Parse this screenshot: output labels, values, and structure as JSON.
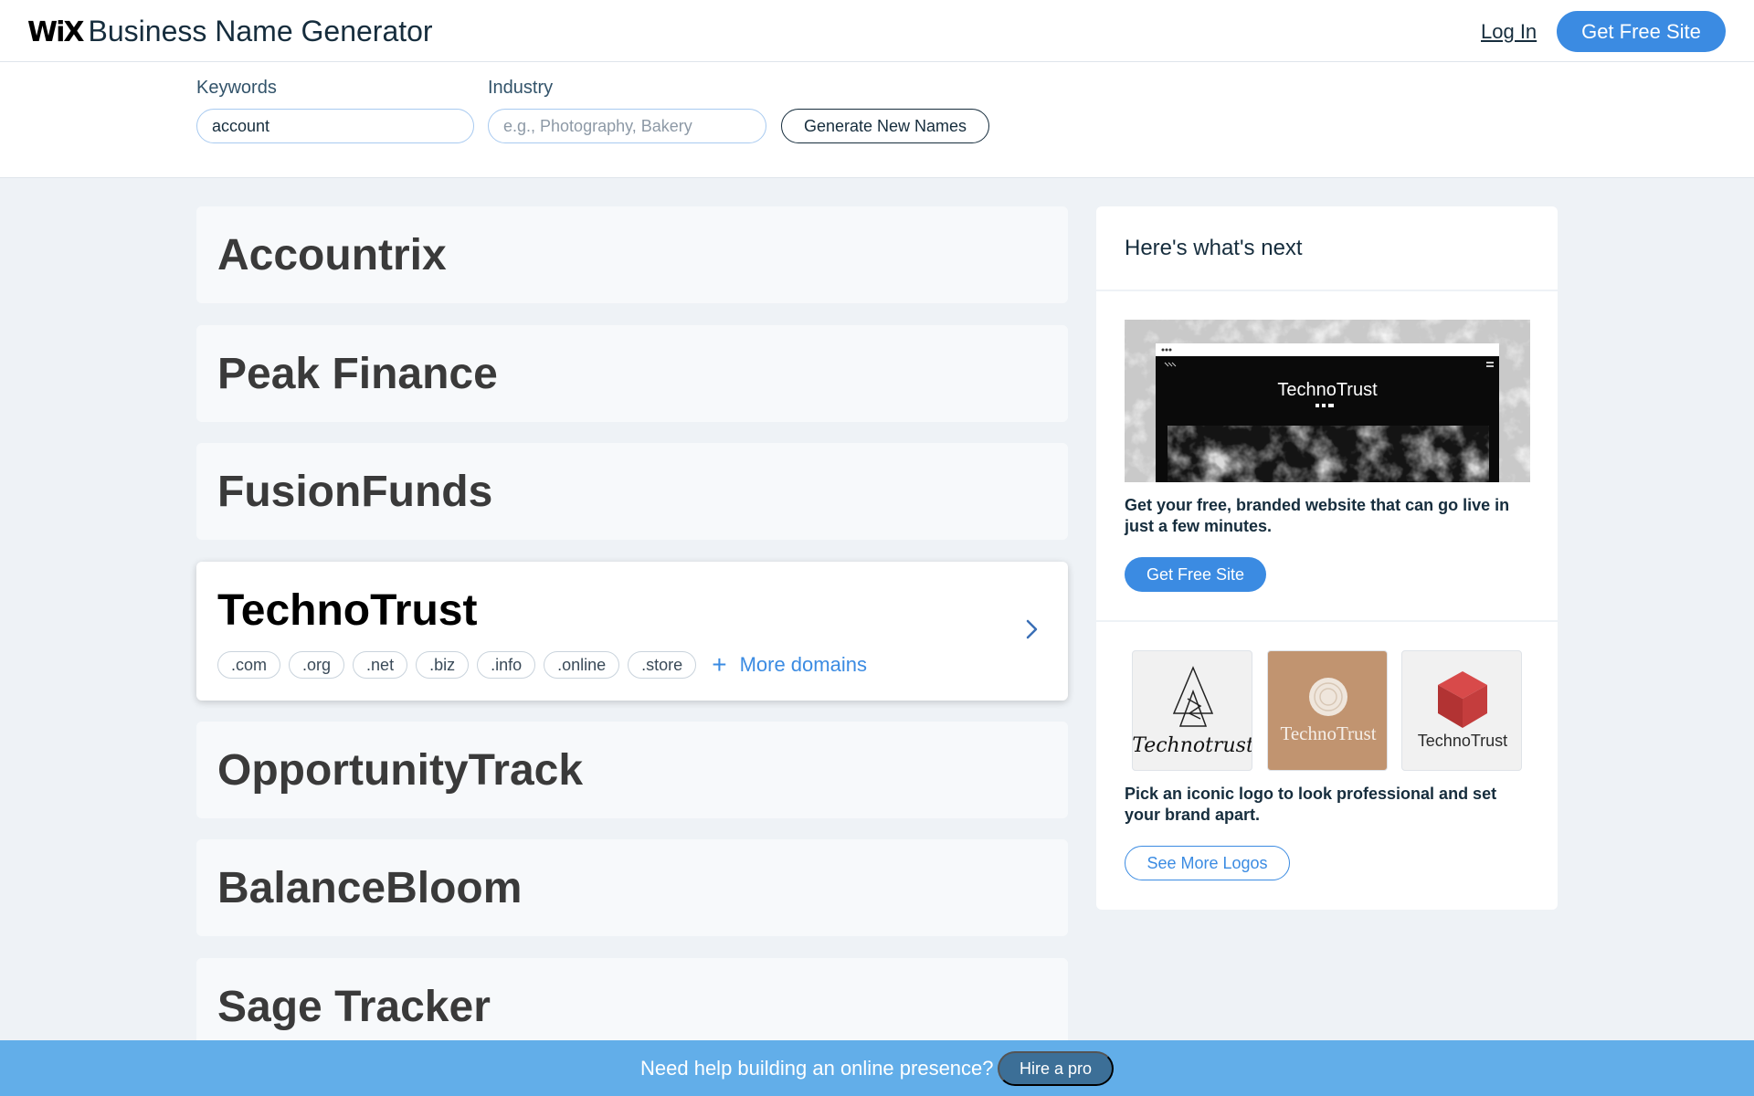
{
  "header": {
    "logo_text": "WiX",
    "title": "Business Name Generator",
    "login_label": "Log In",
    "cta_label": "Get Free Site"
  },
  "search": {
    "keywords_label": "Keywords",
    "keywords_value": "account",
    "industry_label": "Industry",
    "industry_placeholder": "e.g., Photography, Bakery",
    "generate_label": "Generate New Names"
  },
  "names": [
    "Accountrix",
    "Peak Finance",
    "FusionFunds",
    "TechnoTrust",
    "OpportunityTrack",
    "BalanceBloom",
    "Sage Tracker"
  ],
  "selected": {
    "name": "TechnoTrust",
    "domains": [
      ".com",
      ".org",
      ".net",
      ".biz",
      ".info",
      ".online",
      ".store"
    ],
    "more_domains_label": "More domains"
  },
  "panel": {
    "title": "Here's what's next",
    "preview_site_name": "TechnoTrust",
    "site_text": "Get your free, branded website that can go live in just a few minutes.",
    "site_button": "Get Free Site",
    "logos": [
      "Technotrust",
      "TechnoTrust",
      "TechnoTrust"
    ],
    "logo_text": "Pick an iconic logo to look professional and set your brand apart.",
    "logo_button": "See More Logos"
  },
  "footer": {
    "text": "Need help building an online presence?",
    "button": "Hire a pro"
  },
  "colors": {
    "accent": "#3b8be2",
    "footer": "#62aee9",
    "background": "#eef2f6"
  }
}
